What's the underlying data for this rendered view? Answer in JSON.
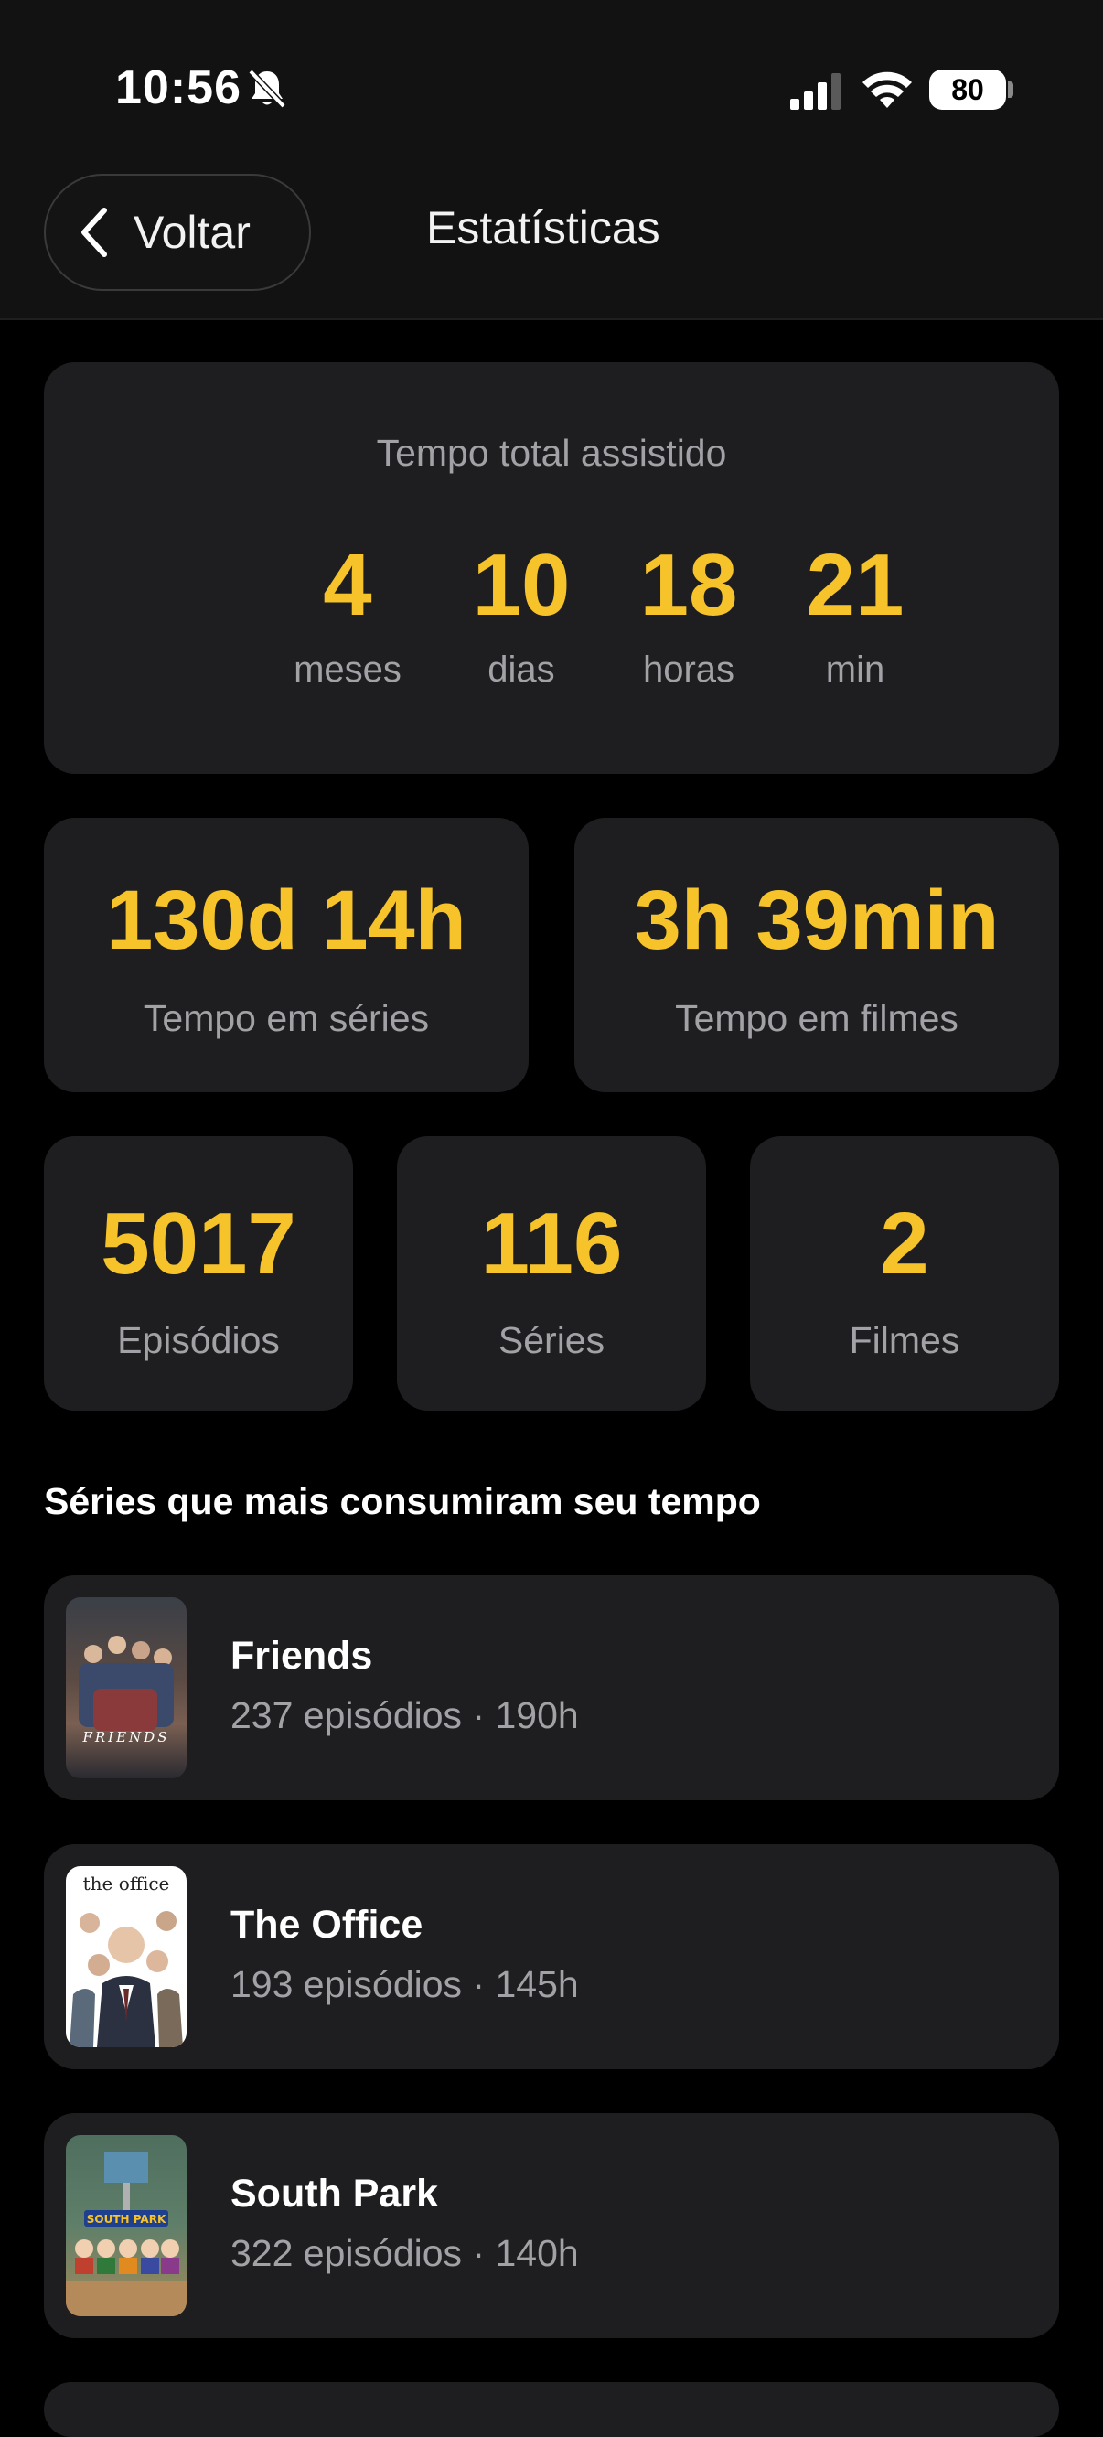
{
  "status_bar": {
    "time": "10:56",
    "battery": "80",
    "icons": [
      "bell-slash-icon",
      "cellular-signal-icon",
      "wifi-icon",
      "battery-icon"
    ]
  },
  "nav": {
    "back_label": "Voltar",
    "title": "Estatísticas"
  },
  "total": {
    "title": "Tempo total assistido",
    "units": [
      {
        "value": "4",
        "label": "meses"
      },
      {
        "value": "10",
        "label": "dias"
      },
      {
        "value": "18",
        "label": "horas"
      },
      {
        "value": "21",
        "label": "min"
      }
    ]
  },
  "time_split": [
    {
      "value": "130d 14h",
      "label": "Tempo em séries"
    },
    {
      "value": "3h 39min",
      "label": "Tempo em filmes"
    }
  ],
  "counts": [
    {
      "value": "5017",
      "label": "Episódios"
    },
    {
      "value": "116",
      "label": "Séries"
    },
    {
      "value": "2",
      "label": "Filmes"
    }
  ],
  "top_series": {
    "title": "Séries que mais consumiram seu tempo",
    "items": [
      {
        "name": "Friends",
        "detail": "237 episódios · 190h",
        "poster_text": "FRIENDS"
      },
      {
        "name": "The Office",
        "detail": "193 episódios · 145h",
        "poster_text": "the office"
      },
      {
        "name": "South Park",
        "detail": "322 episódios · 140h",
        "poster_text": "SOUTH PARK"
      }
    ]
  },
  "colors": {
    "accent": "#f6c32a",
    "card": "#1e1e20",
    "secondary_text": "#a1a1a6",
    "background": "#000000"
  }
}
